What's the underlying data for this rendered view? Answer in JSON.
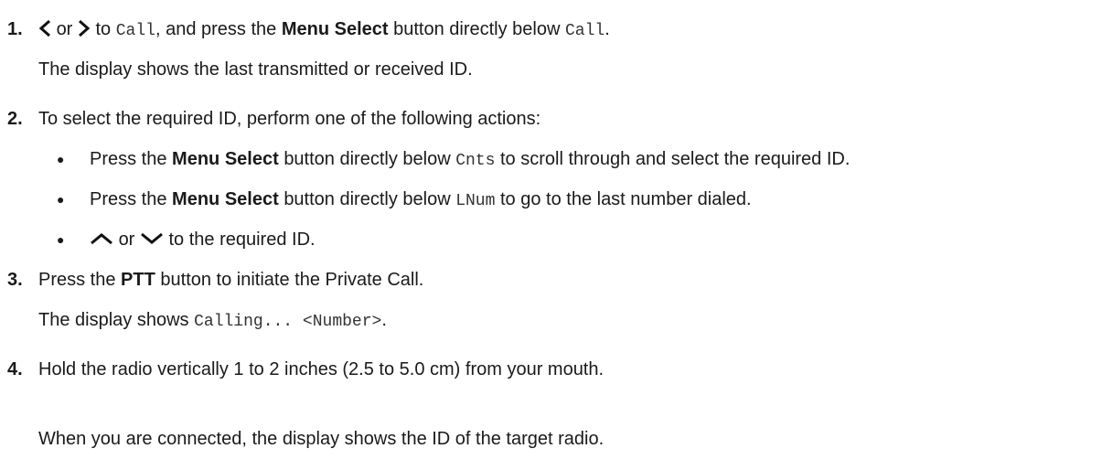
{
  "steps": [
    {
      "number": "1.",
      "parts": {
        "or": "or",
        "to": "to",
        "call_term": "Call",
        "press_the": ", and press the",
        "menu_select": "Menu Select",
        "button_below": "button directly below",
        "call_term_end": "Call",
        "period": "."
      },
      "result": "The display shows the last transmitted or received ID."
    },
    {
      "number": "2.",
      "text": "To select the required ID, perform one of the following actions:",
      "bullets": [
        {
          "press_the": "Press the",
          "menu_select": "Menu Select",
          "button_below": "button directly below",
          "term": "Cnts",
          "rest": "to scroll through and select the required ID."
        },
        {
          "press_the": "Press the",
          "menu_select": "Menu Select",
          "button_below": "button directly below",
          "term": "LNum",
          "rest": "to go to the last number dialed."
        },
        {
          "or": "or",
          "rest": "to the required ID."
        }
      ]
    },
    {
      "number": "3.",
      "press_the": "Press the",
      "ptt": "PTT",
      "rest": "button to initiate the Private Call.",
      "result_prefix": "The display shows",
      "result_term": "Calling... <Number>",
      "result_end": "."
    },
    {
      "number": "4.",
      "text": "Hold the radio vertically 1 to 2 inches (2.5 to 5.0 cm) from your mouth.",
      "result": "When you are connected, the display shows the ID of the target radio."
    }
  ],
  "icons": {
    "left": "chevron-left-icon",
    "right": "chevron-right-icon",
    "up": "chevron-up-icon",
    "down": "chevron-down-icon"
  }
}
